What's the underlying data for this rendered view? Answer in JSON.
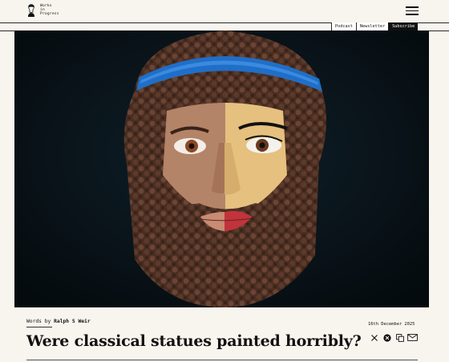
{
  "brand": {
    "logo_lines": [
      "Works",
      "in",
      "Progress"
    ]
  },
  "nav": {
    "podcast": "Podcast",
    "newsletter": "Newsletter",
    "subscribe": "Subscribe"
  },
  "menu": {
    "icon": "hamburger-menu-icon"
  },
  "hero": {
    "subject": "split painted bearded statue head"
  },
  "article": {
    "byline_prefix": "Words by",
    "author": "Ralph S Weir",
    "date": "16th December 2025",
    "title": "Were classical statues painted horribly?"
  },
  "share": {
    "icons": [
      "x-icon",
      "substack-icon",
      "copy-link-icon",
      "email-icon"
    ]
  },
  "colors": {
    "background": "#f8f4ee",
    "ink": "#111111",
    "headband": "#1f6fc8"
  }
}
